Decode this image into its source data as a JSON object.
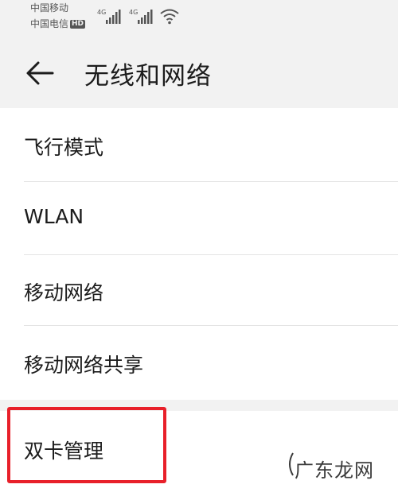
{
  "status_bar": {
    "carrier1": "中国移动",
    "carrier2": "中国电信",
    "hd_badge": "HD",
    "network1": "4G",
    "network2": "4G"
  },
  "header": {
    "title": "无线和网络"
  },
  "items": [
    {
      "label": "飞行模式"
    },
    {
      "label": "WLAN"
    },
    {
      "label": "移动网络"
    },
    {
      "label": "移动网络共享"
    },
    {
      "label": "双卡管理"
    }
  ],
  "watermark": "广东龙网",
  "colors": {
    "background": "#f2f2f2",
    "card": "#ffffff",
    "highlight": "#e8202a"
  }
}
